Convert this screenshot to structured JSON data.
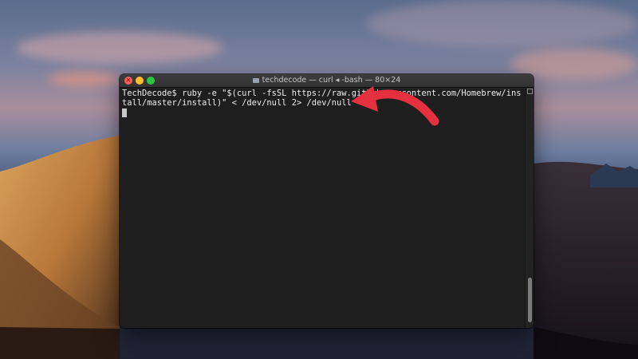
{
  "window": {
    "title": "techdecode — curl ◂ -bash — 80×24"
  },
  "terminal": {
    "lines": [
      "TechDecode$ ruby -e \"$(curl -fsSL https://raw.githubusercontent.com/Homebrew/ins",
      "tall/master/install)\" < /dev/null 2> /dev/null"
    ]
  },
  "colors": {
    "terminal_bg": "#1e1e1e",
    "arrow": "#e5303f",
    "close": "#fe5f57",
    "minimize": "#febc2e",
    "zoom": "#28c840"
  },
  "icons": [
    "close-icon",
    "folder-icon",
    "arrow-annotation-icon"
  ]
}
